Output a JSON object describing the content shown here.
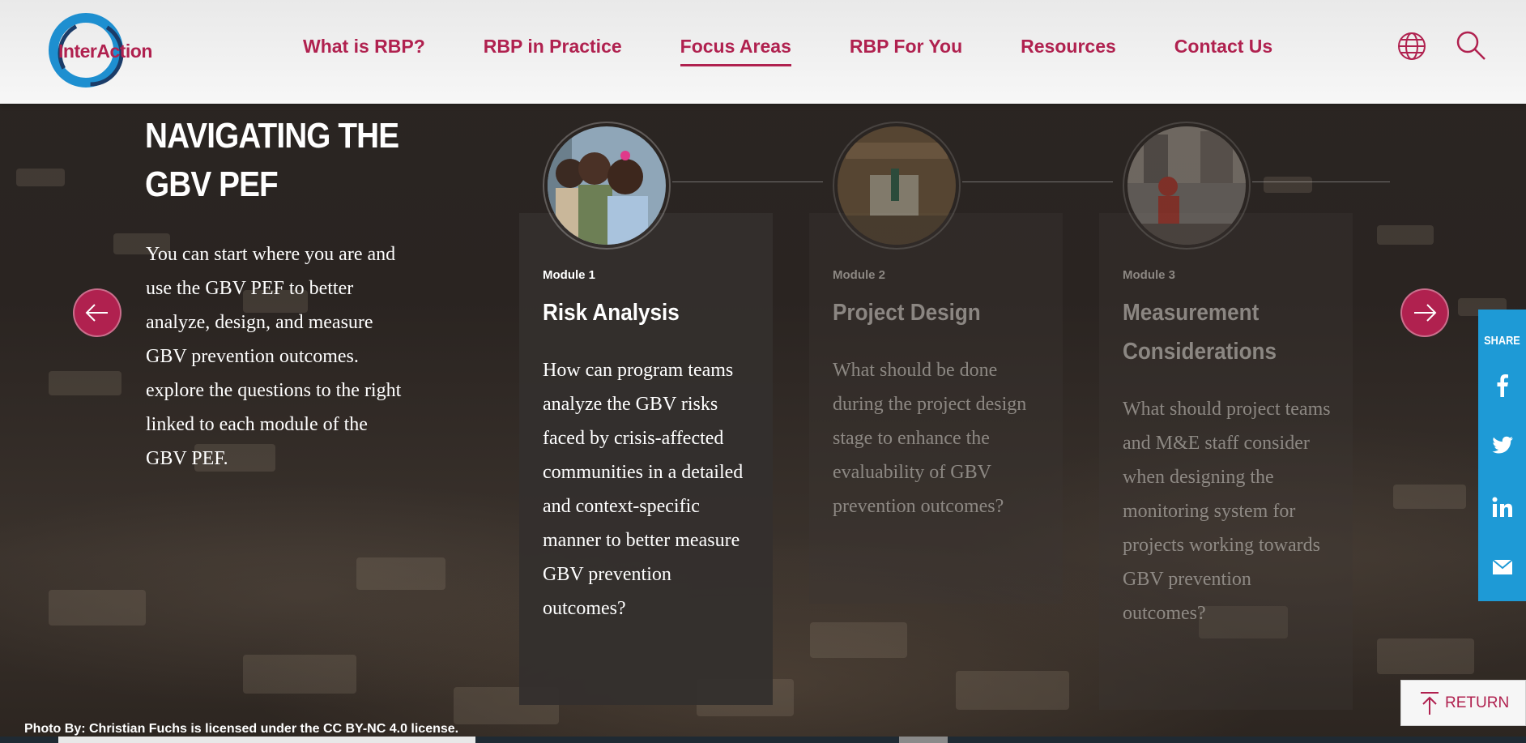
{
  "header": {
    "logo_text": "InterAction",
    "nav": [
      {
        "label": "What is RBP?"
      },
      {
        "label": "RBP in Practice"
      },
      {
        "label": "Focus Areas",
        "active": true
      },
      {
        "label": "RBP For You"
      },
      {
        "label": "Resources"
      },
      {
        "label": "Contact Us"
      }
    ],
    "icons": {
      "globe": "globe-icon",
      "search": "search-icon"
    }
  },
  "intro": {
    "title": "NAVIGATING THE GBV PEF",
    "body": "You can start where you are and use the GBV PEF to better analyze, design, and measure GBV prevention outcomes. explore the questions to the right linked to each module of the GBV PEF."
  },
  "modules": [
    {
      "label": "Module 1",
      "title": "Risk Analysis",
      "description": "How can program teams analyze the GBV risks faced by crisis-affected communities in a detailed and context-specific manner to better measure GBV prevention outcomes?",
      "active": true
    },
    {
      "label": "Module 2",
      "title": "Project Design",
      "description": "What should be done during the project design stage to enhance the evaluability of GBV prevention outcomes?",
      "active": false
    },
    {
      "label": "Module 3",
      "title": "Measurement Considerations",
      "description": "What should project teams and M&E staff consider when designing the monitoring system for projects working towards GBV prevention outcomes?",
      "active": false
    }
  ],
  "share": {
    "label": "SHARE",
    "icons": [
      "facebook-icon",
      "twitter-icon",
      "linkedin-icon",
      "email-icon"
    ]
  },
  "return_button": {
    "label": "RETURN"
  },
  "credit": "Photo By: Christian Fuchs is licensed under the CC BY-NC 4.0 license.",
  "colors": {
    "brand": "#b0214f",
    "share": "#1e9ad6",
    "logo_blue": "#1e8fd0"
  }
}
